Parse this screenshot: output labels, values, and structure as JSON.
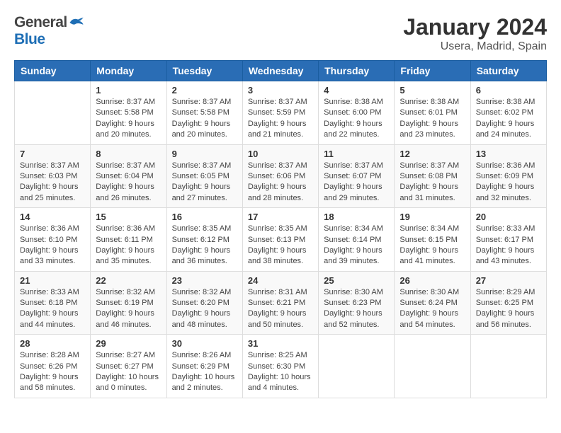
{
  "header": {
    "logo_general": "General",
    "logo_blue": "Blue",
    "month_title": "January 2024",
    "location": "Usera, Madrid, Spain"
  },
  "weekdays": [
    "Sunday",
    "Monday",
    "Tuesday",
    "Wednesday",
    "Thursday",
    "Friday",
    "Saturday"
  ],
  "weeks": [
    [
      {
        "day": "",
        "sunrise": "",
        "sunset": "",
        "daylight": ""
      },
      {
        "day": "1",
        "sunrise": "Sunrise: 8:37 AM",
        "sunset": "Sunset: 5:58 PM",
        "daylight": "Daylight: 9 hours and 20 minutes."
      },
      {
        "day": "2",
        "sunrise": "Sunrise: 8:37 AM",
        "sunset": "Sunset: 5:58 PM",
        "daylight": "Daylight: 9 hours and 20 minutes."
      },
      {
        "day": "3",
        "sunrise": "Sunrise: 8:37 AM",
        "sunset": "Sunset: 5:59 PM",
        "daylight": "Daylight: 9 hours and 21 minutes."
      },
      {
        "day": "4",
        "sunrise": "Sunrise: 8:38 AM",
        "sunset": "Sunset: 6:00 PM",
        "daylight": "Daylight: 9 hours and 22 minutes."
      },
      {
        "day": "5",
        "sunrise": "Sunrise: 8:38 AM",
        "sunset": "Sunset: 6:01 PM",
        "daylight": "Daylight: 9 hours and 23 minutes."
      },
      {
        "day": "6",
        "sunrise": "Sunrise: 8:38 AM",
        "sunset": "Sunset: 6:02 PM",
        "daylight": "Daylight: 9 hours and 24 minutes."
      }
    ],
    [
      {
        "day": "7",
        "sunrise": "Sunrise: 8:37 AM",
        "sunset": "Sunset: 6:03 PM",
        "daylight": "Daylight: 9 hours and 25 minutes."
      },
      {
        "day": "8",
        "sunrise": "Sunrise: 8:37 AM",
        "sunset": "Sunset: 6:04 PM",
        "daylight": "Daylight: 9 hours and 26 minutes."
      },
      {
        "day": "9",
        "sunrise": "Sunrise: 8:37 AM",
        "sunset": "Sunset: 6:05 PM",
        "daylight": "Daylight: 9 hours and 27 minutes."
      },
      {
        "day": "10",
        "sunrise": "Sunrise: 8:37 AM",
        "sunset": "Sunset: 6:06 PM",
        "daylight": "Daylight: 9 hours and 28 minutes."
      },
      {
        "day": "11",
        "sunrise": "Sunrise: 8:37 AM",
        "sunset": "Sunset: 6:07 PM",
        "daylight": "Daylight: 9 hours and 29 minutes."
      },
      {
        "day": "12",
        "sunrise": "Sunrise: 8:37 AM",
        "sunset": "Sunset: 6:08 PM",
        "daylight": "Daylight: 9 hours and 31 minutes."
      },
      {
        "day": "13",
        "sunrise": "Sunrise: 8:36 AM",
        "sunset": "Sunset: 6:09 PM",
        "daylight": "Daylight: 9 hours and 32 minutes."
      }
    ],
    [
      {
        "day": "14",
        "sunrise": "Sunrise: 8:36 AM",
        "sunset": "Sunset: 6:10 PM",
        "daylight": "Daylight: 9 hours and 33 minutes."
      },
      {
        "day": "15",
        "sunrise": "Sunrise: 8:36 AM",
        "sunset": "Sunset: 6:11 PM",
        "daylight": "Daylight: 9 hours and 35 minutes."
      },
      {
        "day": "16",
        "sunrise": "Sunrise: 8:35 AM",
        "sunset": "Sunset: 6:12 PM",
        "daylight": "Daylight: 9 hours and 36 minutes."
      },
      {
        "day": "17",
        "sunrise": "Sunrise: 8:35 AM",
        "sunset": "Sunset: 6:13 PM",
        "daylight": "Daylight: 9 hours and 38 minutes."
      },
      {
        "day": "18",
        "sunrise": "Sunrise: 8:34 AM",
        "sunset": "Sunset: 6:14 PM",
        "daylight": "Daylight: 9 hours and 39 minutes."
      },
      {
        "day": "19",
        "sunrise": "Sunrise: 8:34 AM",
        "sunset": "Sunset: 6:15 PM",
        "daylight": "Daylight: 9 hours and 41 minutes."
      },
      {
        "day": "20",
        "sunrise": "Sunrise: 8:33 AM",
        "sunset": "Sunset: 6:17 PM",
        "daylight": "Daylight: 9 hours and 43 minutes."
      }
    ],
    [
      {
        "day": "21",
        "sunrise": "Sunrise: 8:33 AM",
        "sunset": "Sunset: 6:18 PM",
        "daylight": "Daylight: 9 hours and 44 minutes."
      },
      {
        "day": "22",
        "sunrise": "Sunrise: 8:32 AM",
        "sunset": "Sunset: 6:19 PM",
        "daylight": "Daylight: 9 hours and 46 minutes."
      },
      {
        "day": "23",
        "sunrise": "Sunrise: 8:32 AM",
        "sunset": "Sunset: 6:20 PM",
        "daylight": "Daylight: 9 hours and 48 minutes."
      },
      {
        "day": "24",
        "sunrise": "Sunrise: 8:31 AM",
        "sunset": "Sunset: 6:21 PM",
        "daylight": "Daylight: 9 hours and 50 minutes."
      },
      {
        "day": "25",
        "sunrise": "Sunrise: 8:30 AM",
        "sunset": "Sunset: 6:23 PM",
        "daylight": "Daylight: 9 hours and 52 minutes."
      },
      {
        "day": "26",
        "sunrise": "Sunrise: 8:30 AM",
        "sunset": "Sunset: 6:24 PM",
        "daylight": "Daylight: 9 hours and 54 minutes."
      },
      {
        "day": "27",
        "sunrise": "Sunrise: 8:29 AM",
        "sunset": "Sunset: 6:25 PM",
        "daylight": "Daylight: 9 hours and 56 minutes."
      }
    ],
    [
      {
        "day": "28",
        "sunrise": "Sunrise: 8:28 AM",
        "sunset": "Sunset: 6:26 PM",
        "daylight": "Daylight: 9 hours and 58 minutes."
      },
      {
        "day": "29",
        "sunrise": "Sunrise: 8:27 AM",
        "sunset": "Sunset: 6:27 PM",
        "daylight": "Daylight: 10 hours and 0 minutes."
      },
      {
        "day": "30",
        "sunrise": "Sunrise: 8:26 AM",
        "sunset": "Sunset: 6:29 PM",
        "daylight": "Daylight: 10 hours and 2 minutes."
      },
      {
        "day": "31",
        "sunrise": "Sunrise: 8:25 AM",
        "sunset": "Sunset: 6:30 PM",
        "daylight": "Daylight: 10 hours and 4 minutes."
      },
      {
        "day": "",
        "sunrise": "",
        "sunset": "",
        "daylight": ""
      },
      {
        "day": "",
        "sunrise": "",
        "sunset": "",
        "daylight": ""
      },
      {
        "day": "",
        "sunrise": "",
        "sunset": "",
        "daylight": ""
      }
    ]
  ]
}
